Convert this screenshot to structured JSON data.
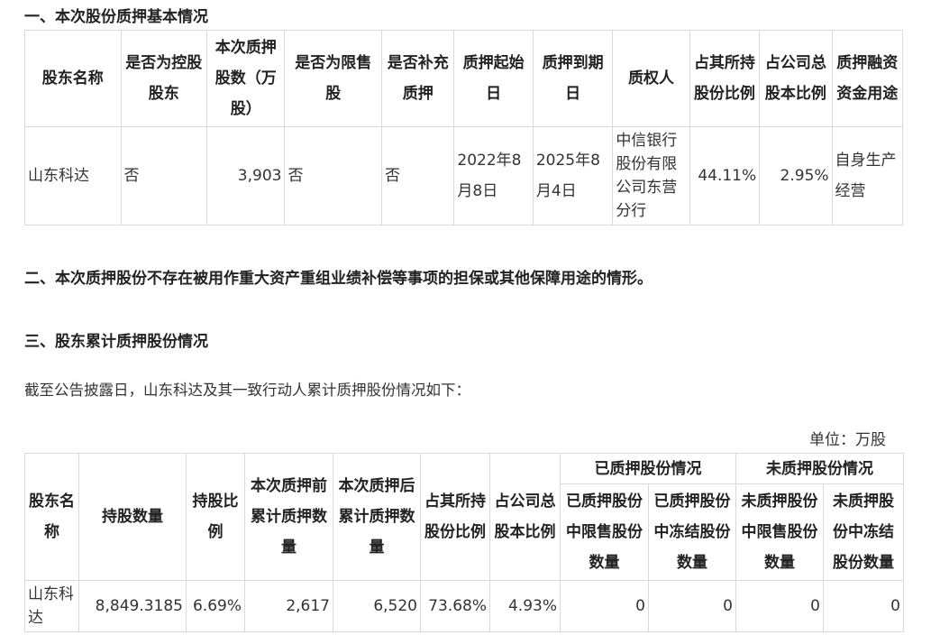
{
  "section1": {
    "title": "一、本次股份质押基本情况",
    "headers": [
      "股东名称",
      "是否为控股股东",
      "本次质押股数（万股）",
      "是否为限售股",
      "是否补充质押",
      "质押起始日",
      "质押到期日",
      "质权人",
      "占其所持股份比例",
      "占公司总股本比例",
      "质押融资资金用途"
    ],
    "row": [
      "山东科达",
      "否",
      "3,903",
      "否",
      "否",
      "2022年8月8日",
      "2025年8月4日",
      "中信银行股份有限公司东营分行",
      "44.11%",
      "2.95%",
      "自身生产经营"
    ]
  },
  "section2": {
    "title": "二、本次质押股份不存在被用作重大资产重组业绩补偿等事项的担保或其他保障用途的情形。"
  },
  "section3": {
    "title": "三、股东累计质押股份情况",
    "intro": "截至公告披露日，山东科达及其一致行动人累计质押股份情况如下：",
    "unit": "单位：万股",
    "headers": [
      "股东名称",
      "持股数量",
      "持股比例",
      "本次质押前累计质押数量",
      "本次质押后累计质押数量",
      "占其所持股份比例",
      "占公司总股本比例"
    ],
    "group_pledged": "已质押股份情况",
    "group_unpledged": "未质押股份情况",
    "sub_headers": [
      "已质押股份中限售股份数量",
      "已质押股份中冻结股份数量",
      "未质押股份中限售股份数量",
      "未质押股份中冻结股份数量"
    ],
    "row": [
      "山东科达",
      "8,849.3185",
      "6.69%",
      "2,617",
      "6,520",
      "73.68%",
      "4.93%",
      "0",
      "0",
      "0",
      "0"
    ]
  }
}
